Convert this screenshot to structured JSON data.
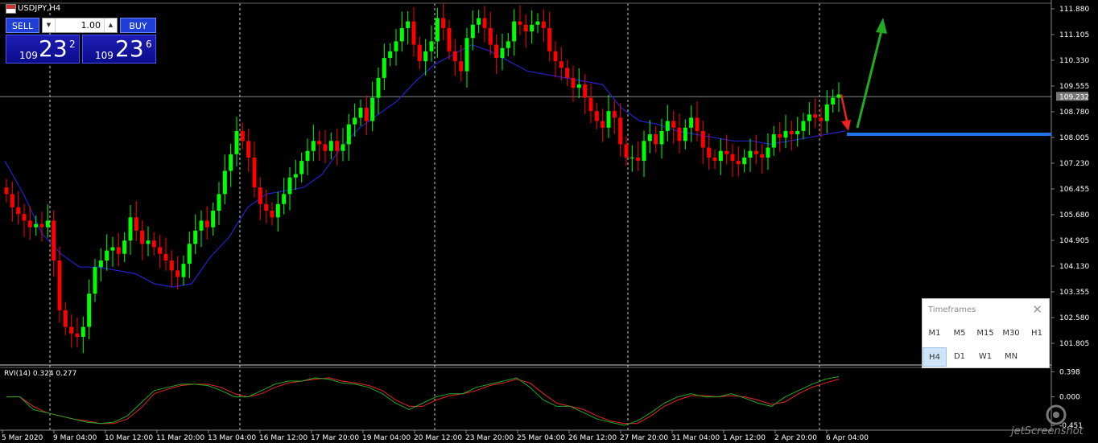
{
  "symbol": "USDJPY,H4",
  "trade_panel": {
    "sell_label": "SELL",
    "buy_label": "BUY",
    "volume": "1.00",
    "sell_price": {
      "prefix": "109",
      "big": "23",
      "sup": "2"
    },
    "buy_price": {
      "prefix": "109",
      "big": "23",
      "sup": "6"
    }
  },
  "rvi_label": "RVI(14) 0.324 0.277",
  "timeframes": {
    "title": "Timeframes",
    "close": "✕",
    "row1": [
      "M1",
      "M5",
      "M15",
      "M30",
      "H1"
    ],
    "row2": [
      "H4",
      "D1",
      "W1",
      "MN"
    ],
    "active": "H4"
  },
  "watermark": "jetScreenshot",
  "colors": {
    "background": "#000000",
    "bull_candle": "#00ff00",
    "bear_candle": "#ff0000",
    "channel_line": "#2222cc",
    "level_line": "#1e74e8",
    "up_arrow": "#22aa22",
    "down_arrow": "#ee2222",
    "rvi_main": "#22aa22",
    "rvi_signal": "#ee2222"
  },
  "chart_data": {
    "type": "candlestick",
    "price_axis_labels": [
      "111.880",
      "111.105",
      "110.330",
      "109.555",
      "108.780",
      "108.005",
      "107.230",
      "106.455",
      "105.680",
      "104.905",
      "104.130",
      "103.355",
      "102.580",
      "101.805"
    ],
    "current_price_label": "109.232",
    "current_price": 109.232,
    "ylim": [
      101.2,
      112.0
    ],
    "time_axis_labels": [
      "5 Mar 2020",
      "9 Mar 04:00",
      "10 Mar 12:00",
      "11 Mar 20:00",
      "13 Mar 04:00",
      "16 Mar 12:00",
      "17 Mar 20:00",
      "19 Mar 04:00",
      "20 Mar 12:00",
      "23 Mar 20:00",
      "25 Mar 04:00",
      "26 Mar 12:00",
      "27 Mar 20:00",
      "31 Mar 04:00",
      "1 Apr 12:00",
      "2 Apr 20:00",
      "6 Apr 04:00"
    ],
    "closes": [
      106.3,
      105.9,
      105.7,
      105.5,
      105.3,
      105.4,
      105.3,
      105.5,
      104.3,
      102.8,
      102.3,
      102.1,
      102.0,
      102.3,
      103.3,
      104.1,
      104.3,
      104.6,
      104.7,
      104.5,
      104.9,
      105.6,
      105.2,
      104.8,
      104.9,
      104.7,
      104.5,
      104.3,
      104.0,
      103.8,
      104.2,
      104.8,
      105.2,
      105.5,
      105.3,
      105.8,
      106.3,
      107.0,
      107.5,
      108.2,
      107.9,
      107.4,
      106.5,
      106.0,
      105.8,
      105.6,
      106.0,
      106.3,
      106.8,
      106.9,
      107.3,
      107.6,
      107.9,
      107.8,
      107.6,
      107.9,
      107.6,
      107.8,
      108.4,
      108.6,
      108.9,
      108.5,
      109.2,
      109.8,
      110.4,
      110.6,
      110.9,
      111.3,
      111.5,
      110.8,
      110.3,
      110.6,
      110.9,
      111.6,
      111.3,
      110.6,
      110.3,
      110.0,
      111.0,
      111.4,
      111.6,
      111.3,
      110.8,
      110.4,
      110.7,
      110.9,
      111.5,
      111.4,
      111.2,
      111.4,
      111.5,
      111.3,
      110.6,
      110.3,
      110.1,
      109.8,
      109.5,
      109.6,
      109.2,
      108.8,
      108.5,
      108.3,
      108.8,
      108.6,
      107.8,
      107.4,
      107.4,
      107.3,
      107.9,
      108.1,
      107.8,
      108.2,
      108.5,
      108.3,
      107.9,
      108.3,
      108.6,
      108.2,
      107.7,
      107.4,
      107.3,
      107.6,
      107.5,
      107.3,
      107.2,
      107.4,
      107.6,
      107.5,
      107.4,
      107.7,
      108.1,
      108.0,
      108.2,
      108.1,
      108.2,
      108.5,
      108.7,
      108.6,
      108.5,
      109.0,
      109.2,
      109.3
    ],
    "channel_line": [
      107.3,
      106.3,
      105.1,
      104.5,
      104.1,
      104.1,
      104.0,
      103.9,
      103.6,
      103.5,
      103.6,
      104.4,
      105.0,
      105.9,
      106.3,
      106.4,
      106.5,
      106.9,
      107.7,
      108.3,
      108.7,
      109.1,
      109.7,
      110.2,
      110.5,
      110.8,
      110.6,
      110.3,
      110.0,
      109.9,
      109.8,
      109.7,
      109.6,
      108.9,
      108.5,
      108.4,
      108.2,
      108.1,
      108.0,
      107.9,
      107.9,
      107.8,
      107.9,
      108.0,
      108.1,
      108.2
    ],
    "level_line": 108.1,
    "arrows": [
      {
        "direction": "up"
      },
      {
        "direction": "down"
      }
    ],
    "indicator": {
      "name": "RVI(14)",
      "main": 0.324,
      "signal": 0.277,
      "axis_labels": [
        "0.398",
        "0.000",
        "-0.451"
      ],
      "ylim": [
        -0.5,
        0.44
      ],
      "main_series": [
        0.0,
        0.0,
        -0.2,
        -0.25,
        -0.3,
        -0.35,
        -0.4,
        -0.42,
        -0.4,
        -0.3,
        -0.1,
        0.1,
        0.15,
        0.2,
        0.2,
        0.18,
        0.1,
        0.0,
        0.0,
        0.1,
        0.2,
        0.25,
        0.25,
        0.3,
        0.28,
        0.22,
        0.2,
        0.15,
        0.05,
        -0.1,
        -0.2,
        -0.1,
        0.0,
        0.05,
        0.05,
        0.15,
        0.2,
        0.25,
        0.3,
        0.15,
        -0.05,
        -0.15,
        -0.15,
        -0.25,
        -0.35,
        -0.4,
        -0.45,
        -0.38,
        -0.25,
        -0.1,
        0.0,
        0.05,
        0.0,
        0.0,
        0.05,
        -0.02,
        -0.1,
        -0.15,
        0.0,
        0.1,
        0.2,
        0.28,
        0.32
      ],
      "signal_series": [
        0.0,
        0.0,
        -0.15,
        -0.25,
        -0.3,
        -0.35,
        -0.38,
        -0.42,
        -0.42,
        -0.35,
        -0.18,
        0.05,
        0.12,
        0.18,
        0.2,
        0.2,
        0.15,
        0.05,
        0.0,
        0.05,
        0.15,
        0.22,
        0.25,
        0.28,
        0.3,
        0.25,
        0.22,
        0.18,
        0.1,
        -0.05,
        -0.15,
        -0.15,
        -0.05,
        0.02,
        0.05,
        0.1,
        0.18,
        0.22,
        0.28,
        0.22,
        0.05,
        -0.1,
        -0.15,
        -0.2,
        -0.3,
        -0.38,
        -0.42,
        -0.42,
        -0.3,
        -0.15,
        -0.05,
        0.02,
        0.02,
        0.0,
        0.02,
        0.0,
        -0.05,
        -0.12,
        -0.08,
        0.05,
        0.15,
        0.22,
        0.28
      ]
    }
  }
}
